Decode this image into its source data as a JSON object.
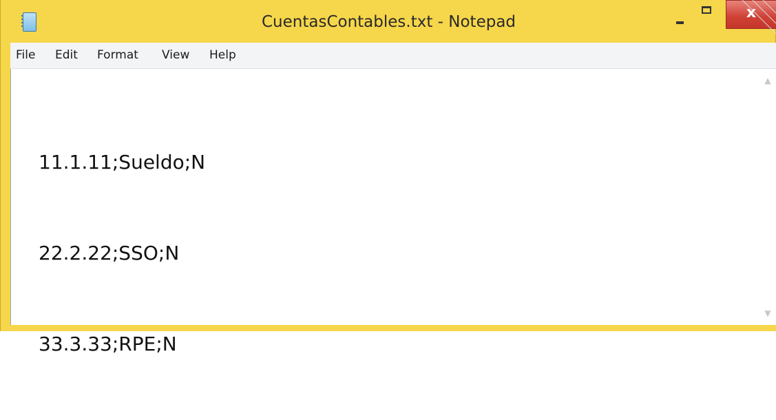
{
  "window": {
    "title": "CuentasContables.txt - Notepad",
    "controls": {
      "minimize_icon": "minimize-icon",
      "maximize_icon": "maximize-icon",
      "close_label": "x"
    }
  },
  "menu": {
    "items": [
      {
        "label": "File"
      },
      {
        "label": "Edit"
      },
      {
        "label": "Format"
      },
      {
        "label": "View"
      },
      {
        "label": "Help"
      }
    ]
  },
  "document": {
    "lines": [
      "11.1.11;Sueldo;N",
      "22.2.22;SSO;N",
      "33.3.33;RPE;N"
    ]
  },
  "colors": {
    "frame": "#f6d64a",
    "close_button": "#cf4035",
    "menubar": "#f3f4f6",
    "editor_bg": "#ffffff"
  }
}
